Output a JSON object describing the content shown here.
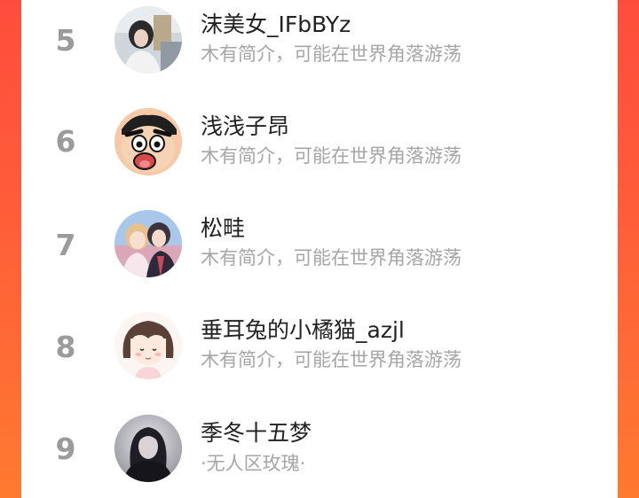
{
  "leaderboard": {
    "entries": [
      {
        "rank": "5",
        "name": "沫美女_IFbBYz",
        "bio": "木有简介，可能在世界角落游荡",
        "avatar": "avatar-photo-girl"
      },
      {
        "rank": "6",
        "name": "浅浅子昂",
        "bio": "木有简介，可能在世界角落游荡",
        "avatar": "avatar-crayon-shinchan"
      },
      {
        "rank": "7",
        "name": "松畦",
        "bio": "木有简介，可能在世界角落游荡",
        "avatar": "avatar-anime-couple"
      },
      {
        "rank": "8",
        "name": "垂耳兔的小橘猫_azjl",
        "bio": "木有简介，可能在世界角落游荡",
        "avatar": "avatar-cartoon-girl"
      },
      {
        "rank": "9",
        "name": "季冬十五梦",
        "bio": "·无人区玫瑰·",
        "avatar": "avatar-dark-figure"
      }
    ]
  },
  "colors": {
    "background_top": "#ff4d3d",
    "background_bottom": "#ff7a2f",
    "rank_gray": "#9b9b9b",
    "bio_gray": "#a6a6a6"
  }
}
